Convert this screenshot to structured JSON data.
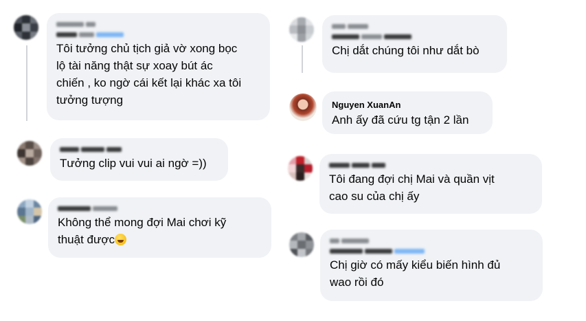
{
  "colors": {
    "bubble": "#f0f2f5",
    "text": "#050505",
    "thread": "#d0d3d8"
  },
  "comments": [
    {
      "id": "c1",
      "name": "",
      "lines": [
        "Tôi tưởng chủ tịch giả vờ xong bọc",
        "lộ tài năng thật sự xoay bút ác",
        "chiến , ko ngờ cái kết lại khác xa tôi",
        "tưởng tượng"
      ]
    },
    {
      "id": "c2",
      "name": "",
      "lines": [
        "Tưởng clip vui vui ai ngờ =))"
      ]
    },
    {
      "id": "c3",
      "name": "",
      "lines": [
        "Không thể mong đợi Mai chơi kỹ",
        "thuật được"
      ],
      "emoji": "grinning-sweat-emoji"
    },
    {
      "id": "c4",
      "name": "",
      "lines": [
        "Chị dắt chúng tôi như dắt bò"
      ]
    },
    {
      "id": "c5",
      "name": "Nguyen XuanAn",
      "lines": [
        "Anh ấy đã cứu tg tận 2 lần"
      ]
    },
    {
      "id": "c6",
      "name": "",
      "lines": [
        "Tôi đang đợi chị Mai và quần vịt",
        "cao su của chị ấy"
      ]
    },
    {
      "id": "c7",
      "name": "",
      "lines": [
        "Chị giờ có mấy kiểu biến hình đủ",
        "wao rồi đó"
      ]
    }
  ]
}
